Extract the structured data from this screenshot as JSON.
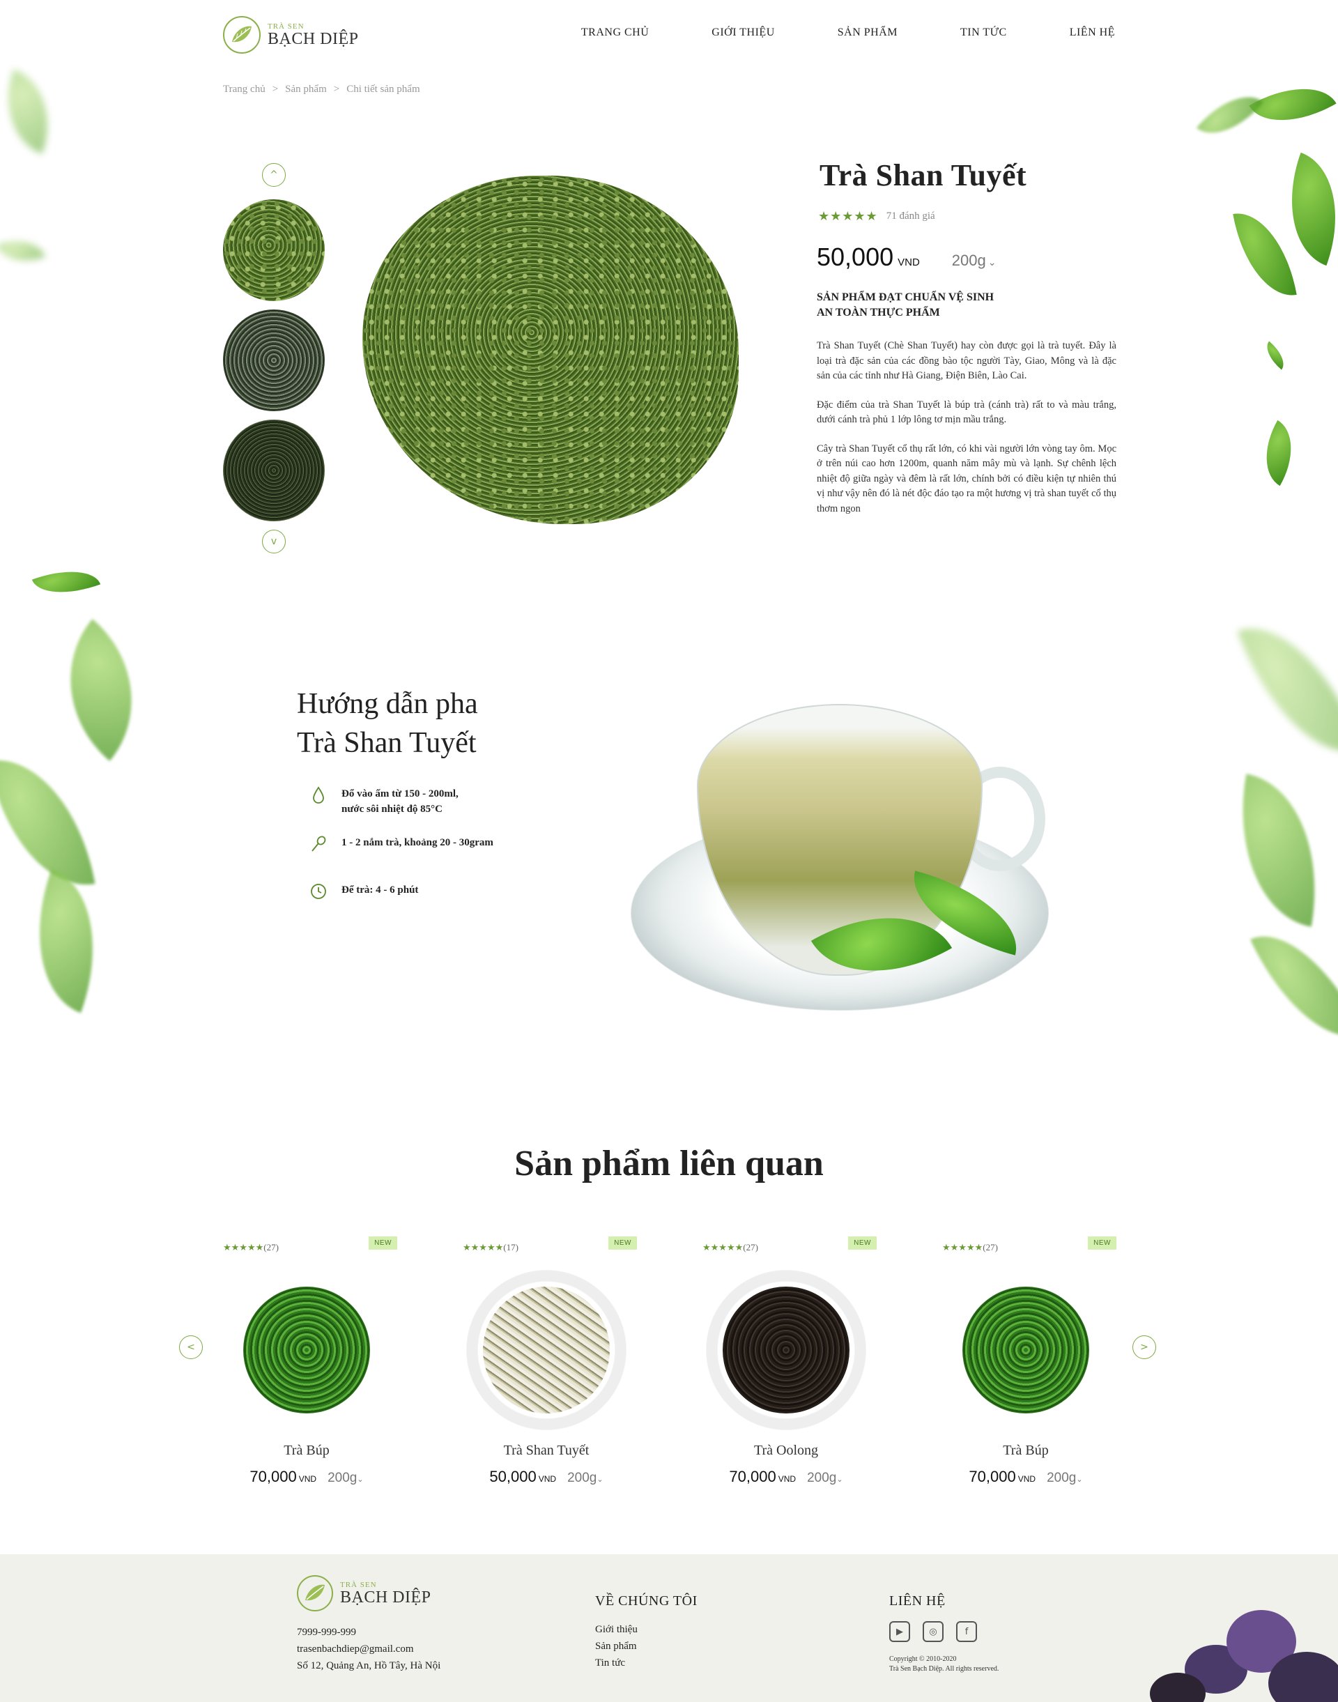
{
  "brand": {
    "small": "TRÀ SEN",
    "name": "BẠCH DIỆP"
  },
  "nav": [
    "TRANG CHỦ",
    "GIỚI THIỆU",
    "SẢN PHẨM",
    "TIN TỨC",
    "LIÊN HỆ"
  ],
  "breadcrumb": [
    "Trang chủ",
    "Sản phẩm",
    "Chi tiết sản phẩm"
  ],
  "breadcrumb_sep": ">",
  "gallery": {
    "up_icon": "chevron-up-icon",
    "down_icon": "chevron-down-icon",
    "up": "^",
    "down": "v"
  },
  "product": {
    "title": "Trà Shan Tuyết",
    "stars": "★★★★★",
    "rating_count": "71 đánh giá",
    "price": "50,000",
    "currency": "VND",
    "weight": "200g",
    "weight_chev": "⌄",
    "cert_line1": "SẢN PHẨM ĐẠT CHUẨN VỆ SINH",
    "cert_line2": "AN TOÀN THỰC PHẨM",
    "desc1": "Trà Shan Tuyết (Chè Shan Tuyết) hay còn được gọi là trà tuyết. Đây là loại trà đặc sản của các đồng bào tộc người Tày, Giao, Mông và là đặc sản của các tỉnh như Hà Giang, Điện Biên, Lào Cai.",
    "desc2": "Đặc điểm của trà Shan Tuyết là búp trà (cánh trà) rất to và màu trắng, dưới cánh trà phủ 1 lớp lông tơ mịn mầu trắng.",
    "desc3": "Cây trà Shan Tuyết cổ thụ rất lớn, có khi vài người lớn vòng tay ôm. Mọc ở trên núi cao hơn 1200m, quanh năm mây mù và lạnh. Sự chênh lệch nhiệt độ giữa ngày và đêm là rất lớn, chính bởi có điều kiện tự nhiên thú vị như vậy nên đó là nét độc đáo tạo ra một hương vị trà shan tuyết cổ thụ thơm ngon"
  },
  "guide": {
    "title_line1": "Hướng dẫn pha",
    "title_line2": "Trà Shan Tuyết",
    "steps": [
      {
        "icon": "water-drop-icon",
        "glyph": "💧",
        "line1": "Đổ vào ấm từ 150 - 200ml,",
        "line2": "nước sôi nhiệt độ 85°C"
      },
      {
        "icon": "spoon-icon",
        "glyph": "⚲",
        "line1": "1 - 2 nắm trà, khoảng 20 - 30gram",
        "line2": ""
      },
      {
        "icon": "clock-icon",
        "glyph": "◷",
        "line1": "Để trà: 4 - 6 phút",
        "line2": ""
      }
    ]
  },
  "related": {
    "title": "Sản phẩm liên quan",
    "prev": "<",
    "next": ">",
    "items": [
      {
        "stars": "★★★★★",
        "count": "(27)",
        "badge": "NEW",
        "name": "Trà Búp",
        "price": "70,000",
        "currency": "VND",
        "weight": "200g",
        "chev": "⌄"
      },
      {
        "stars": "★★★★★",
        "count": "(17)",
        "badge": "NEW",
        "name": "Trà Shan Tuyết",
        "price": "50,000",
        "currency": "VND",
        "weight": "200g",
        "chev": "⌄"
      },
      {
        "stars": "★★★★★",
        "count": "(27)",
        "badge": "NEW",
        "name": "Trà Oolong",
        "price": "70,000",
        "currency": "VND",
        "weight": "200g",
        "chev": "⌄"
      },
      {
        "stars": "★★★★★",
        "count": "(27)",
        "badge": "NEW",
        "name": "Trà Búp",
        "price": "70,000",
        "currency": "VND",
        "weight": "200g",
        "chev": "⌄"
      }
    ]
  },
  "footer": {
    "phone": "7999-999-999",
    "email": "trasenbachdiep@gmail.com",
    "address": "Số 12, Quảng An, Hồ Tây, Hà Nội",
    "about_title": "VỀ CHÚNG TÔI",
    "about_links": [
      "Giới thiệu",
      "Sản phẩm",
      "Tin tức"
    ],
    "contact_title": "LIÊN HỆ",
    "social": [
      {
        "icon": "youtube-icon",
        "glyph": "▶"
      },
      {
        "icon": "instagram-icon",
        "glyph": "◎"
      },
      {
        "icon": "facebook-icon",
        "glyph": "f"
      }
    ],
    "copyright_line1": "Copyright © 2010-2020",
    "copyright_line2": "Trà Sen Bạch Diệp. All rights reserved."
  },
  "colors": {
    "accent": "#7da940",
    "star": "#6c9a35",
    "badge_bg": "#d4efb0",
    "footer_bg": "#f1f1ec"
  }
}
